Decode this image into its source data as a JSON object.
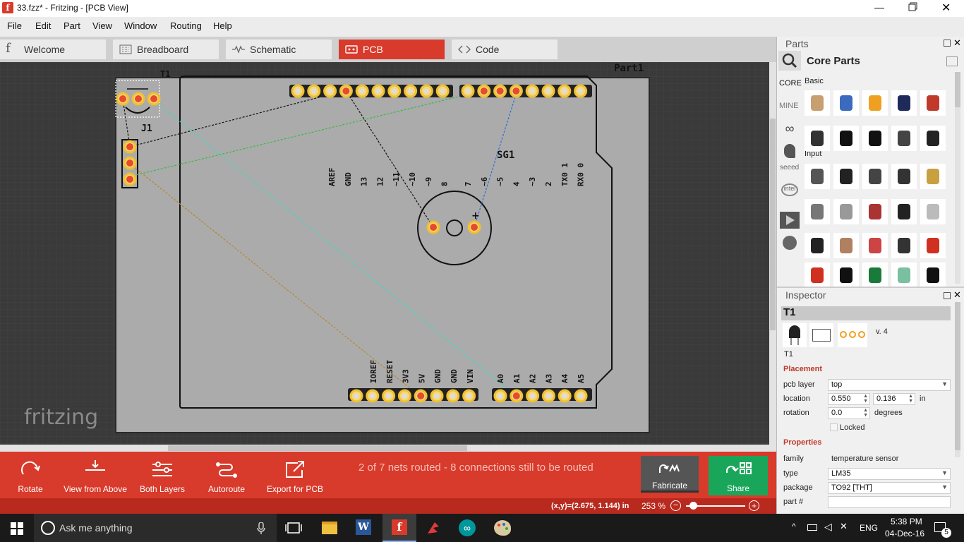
{
  "window": {
    "title": "33.fzz* - Fritzing - [PCB View]"
  },
  "menu": [
    "File",
    "Edit",
    "Part",
    "View",
    "Window",
    "Routing",
    "Help"
  ],
  "tabs": [
    {
      "label": "Welcome",
      "icon": "fritzing-icon"
    },
    {
      "label": "Breadboard",
      "icon": "breadboard-icon"
    },
    {
      "label": "Schematic",
      "icon": "schematic-icon"
    },
    {
      "label": "PCB",
      "icon": "pcb-icon",
      "active": true
    },
    {
      "label": "Code",
      "icon": "code-icon"
    }
  ],
  "canvas": {
    "part_label": "Part1",
    "labels": {
      "t1": "T1",
      "j1": "J1",
      "sg1": "SG1"
    },
    "top_pins_left": [
      "AREF",
      "GND",
      "13",
      "12",
      "~11",
      "~10",
      "~9",
      "8"
    ],
    "top_pins_right": [
      "7",
      "~6",
      "~5",
      "4",
      "~3",
      "2",
      "TX0 1",
      "RX0 0"
    ],
    "bottom_pins_left": [
      "IOREF",
      "RESET",
      "3V3",
      "5V",
      "GND",
      "GND",
      "VIN"
    ],
    "bottom_pins_right": [
      "A0",
      "A1",
      "A2",
      "A3",
      "A4",
      "A5"
    ],
    "plus_sign": "+",
    "watermark": "fritzing"
  },
  "toolbar": {
    "rotate": "Rotate",
    "view_from_above": "View from Above",
    "both_layers": "Both Layers",
    "autoroute": "Autoroute",
    "export_pcb": "Export for PCB",
    "routing_status": "2 of 7 nets routed - 8 connections still to be routed",
    "fabricate": "Fabricate",
    "share": "Share"
  },
  "status": {
    "coords": "(x,y)=(2.675, 1.144) in",
    "zoom": "253 %"
  },
  "parts_panel": {
    "title": "Parts",
    "bin_title": "Core Parts",
    "sidebar": [
      "CORE",
      "MINE"
    ],
    "sections": {
      "basic": "Basic",
      "input": "Input"
    }
  },
  "inspector": {
    "title": "Inspector",
    "part_title": "T1",
    "version": "v. 4",
    "part_name": "T1",
    "placement_header": "Placement",
    "pcb_layer_label": "pcb layer",
    "pcb_layer_value": "top",
    "location_label": "location",
    "location_x": "0.550",
    "location_y": "0.136",
    "location_unit": "in",
    "rotation_label": "rotation",
    "rotation_value": "0.0",
    "rotation_unit": "degrees",
    "locked_label": "Locked",
    "properties_header": "Properties",
    "family_label": "family",
    "family_value": "temperature sensor",
    "type_label": "type",
    "type_value": "LM35",
    "package_label": "package",
    "package_value": "TO92 [THT]",
    "partnum_label": "part #",
    "partnum_value": ""
  },
  "taskbar": {
    "search_placeholder": "Ask me anything",
    "lang": "ENG",
    "time": "5:38 PM",
    "date": "04-Dec-16",
    "notif_count": "5"
  },
  "colors": {
    "accent": "#d83a2b",
    "share": "#1aa65a",
    "board": "#aaaaaa",
    "pad_ring": "#f0c030",
    "pad_center": "#e84a2a"
  }
}
